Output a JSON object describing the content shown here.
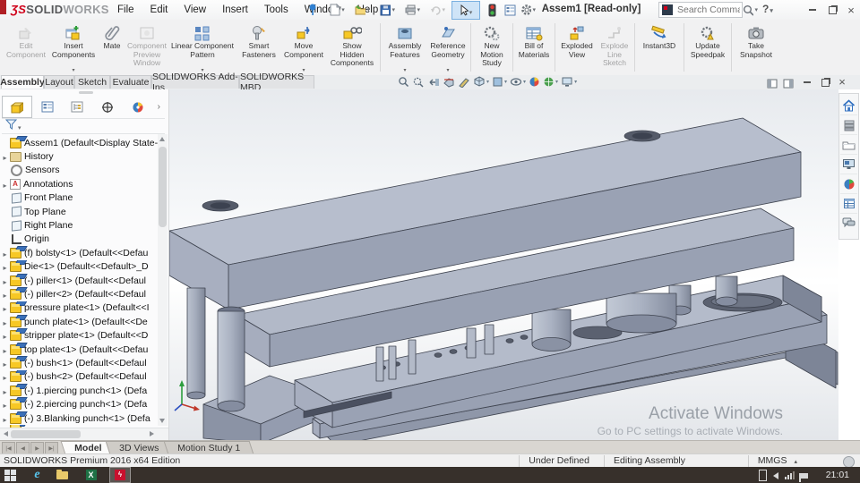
{
  "titlebar": {
    "logo_ds": "ƷS",
    "logo_solid": "SOLID",
    "logo_works": "WORKS",
    "menus": [
      "File",
      "Edit",
      "View",
      "Insert",
      "Tools",
      "Window",
      "Help"
    ],
    "document_title": "Assem1 [Read-only]",
    "search_placeholder": "Search Commands",
    "help_label": "?"
  },
  "ribbon": {
    "buttons": [
      {
        "label": "Edit\nComponent",
        "enabled": false
      },
      {
        "label": "Insert\nComponents",
        "enabled": true,
        "dropdown": true
      },
      {
        "label": "Mate",
        "enabled": true
      },
      {
        "label": "Component\nPreview\nWindow",
        "enabled": false
      },
      {
        "label": "Linear Component\nPattern",
        "enabled": true,
        "dropdown": true
      },
      {
        "label": "Smart\nFasteners",
        "enabled": true
      },
      {
        "label": "Move\nComponent",
        "enabled": true,
        "dropdown": true
      },
      {
        "label": "Show\nHidden\nComponents",
        "enabled": true
      },
      {
        "label": "Assembly\nFeatures",
        "enabled": true,
        "dropdown": true
      },
      {
        "label": "Reference\nGeometry",
        "enabled": true,
        "dropdown": true
      },
      {
        "label": "New\nMotion\nStudy",
        "enabled": true
      },
      {
        "label": "Bill of\nMaterials",
        "enabled": true
      },
      {
        "label": "Exploded\nView",
        "enabled": true
      },
      {
        "label": "Explode\nLine\nSketch",
        "enabled": false
      },
      {
        "label": "Instant3D",
        "enabled": true
      },
      {
        "label": "Update\nSpeedpak",
        "enabled": true
      },
      {
        "label": "Take\nSnapshot",
        "enabled": true
      }
    ]
  },
  "command_tabs": {
    "items": [
      "Assembly",
      "Layout",
      "Sketch",
      "Evaluate",
      "SOLIDWORKS Add-Ins",
      "SOLIDWORKS MBD"
    ],
    "active": "Assembly"
  },
  "feature_tree": {
    "root": "Assem1 (Default<Display State-1>",
    "items": [
      {
        "label": "History"
      },
      {
        "label": "Sensors"
      },
      {
        "label": "Annotations"
      },
      {
        "label": "Front Plane"
      },
      {
        "label": "Top Plane"
      },
      {
        "label": "Right Plane"
      },
      {
        "label": "Origin"
      },
      {
        "label": "(f) bolsty<1> (Default<<Defau"
      },
      {
        "label": "Die<1> (Default<<Default>_D"
      },
      {
        "label": "(-) piller<1> (Default<<Defaul"
      },
      {
        "label": "(-) piller<2> (Default<<Defaul"
      },
      {
        "label": "pressure plate<1> (Default<<I"
      },
      {
        "label": "punch plate<1> (Default<<De"
      },
      {
        "label": "stripper plate<1> (Default<<D"
      },
      {
        "label": "top plate<1> (Default<<Defau"
      },
      {
        "label": "(-) bush<1> (Default<<Defaul"
      },
      {
        "label": "(-) bush<2> (Default<<Defaul"
      },
      {
        "label": "(-) 1.piercing punch<1> (Defa"
      },
      {
        "label": "(-) 2.piercing punch<1> (Defa"
      },
      {
        "label": "(-) 3.Blanking punch<1> (Defa"
      }
    ]
  },
  "viewport": {
    "watermark_title": "Activate Windows",
    "watermark_sub": "Go to PC settings to activate Windows."
  },
  "bottom_tabs": {
    "items": [
      "Model",
      "3D Views",
      "Motion Study 1"
    ],
    "active": "Model"
  },
  "statusbar": {
    "left": "SOLIDWORKS Premium 2016 x64 Edition",
    "cells": [
      "Under Defined",
      "Editing Assembly",
      "MMGS"
    ]
  },
  "taskbar": {
    "time": "21:01"
  },
  "icons": {
    "titlebar": [
      "new-document",
      "open",
      "save",
      "print",
      "undo",
      "select-cursor",
      "rebuild-traffic-light",
      "options-list",
      "settings-gear",
      "pin",
      "search-magnifier"
    ],
    "headsup": [
      "zoom-to-fit",
      "zoom-to-area",
      "previous-view",
      "section-view",
      "sketch-visibility",
      "view-orientation",
      "display-style",
      "hide-show-items",
      "edit-appearance",
      "apply-scene",
      "view-settings"
    ],
    "taskpane": [
      "home",
      "design-library",
      "file-explorer",
      "view-palette",
      "appearances",
      "custom-properties",
      "forum"
    ],
    "taskbar": [
      "start",
      "internet-explorer",
      "file-explorer",
      "excel",
      "solidworks",
      "battery",
      "volume",
      "network",
      "notifications-flag"
    ]
  },
  "colors": {
    "sw_red": "#d0021b",
    "selection_blue": "#cfe4f7",
    "model_gray": "#9aa2b4",
    "taskbar_bg": "#37302b"
  }
}
